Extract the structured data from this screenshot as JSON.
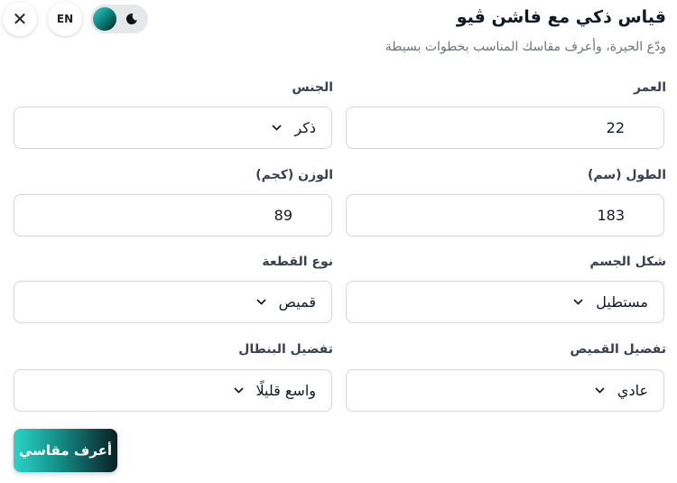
{
  "header": {
    "title": "قياس ذكي مع فاشن ڤيو",
    "subtitle": "ودّع الحيرة، وأعرف مقاسك المناسب بخطوات بسيطة",
    "close_icon": "close-icon",
    "language_label": "EN",
    "theme_toggle": {
      "state": "dark-mode-off",
      "icon": "moon-icon"
    }
  },
  "form": {
    "age": {
      "label": "العمر",
      "value": "22"
    },
    "gender": {
      "label": "الجنس",
      "value": "ذكر"
    },
    "height": {
      "label": "الطول (سم)",
      "value": "183"
    },
    "weight": {
      "label": "الوزن (كجم)",
      "value": "89"
    },
    "body_shape": {
      "label": "شكل الجسم",
      "value": "مستطيل"
    },
    "garment_type": {
      "label": "نوع القطعة",
      "value": "قميص"
    },
    "shirt_fit": {
      "label": "تفضيل القميص",
      "value": "عادي"
    },
    "pants_fit": {
      "label": "تفضيل البنطال",
      "value": "واسع قليلًا"
    }
  },
  "submit_label": "أعرف مقاسي",
  "colors": {
    "accent_start": "#2bd4c7",
    "accent_end": "#0b1f24",
    "border": "#d1d5db",
    "subtitle": "#6b7280"
  }
}
